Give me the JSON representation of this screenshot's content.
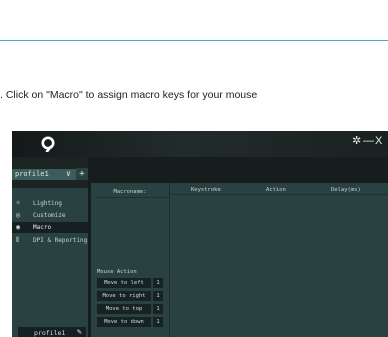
{
  "instruction": ". Click on \"Macro\" to assign macro keys for your mouse",
  "app": {
    "window_controls": {
      "settings": "✲",
      "minimize": "—",
      "close": "X"
    },
    "sidebar": {
      "profile_select": {
        "value": "profile1",
        "chevron": "∨",
        "add": "+"
      },
      "menu": [
        {
          "label": "Lighting",
          "icon": "bulb-icon",
          "glyph": "☼",
          "active": false
        },
        {
          "label": "Customize",
          "icon": "target-icon",
          "glyph": "◎",
          "active": false
        },
        {
          "label": "Macro",
          "icon": "macro-icon",
          "glyph": "◉",
          "active": true
        },
        {
          "label": "DPI & Reporting",
          "icon": "sliders-icon",
          "glyph": "⫴",
          "active": false
        }
      ],
      "profile_footer": {
        "label": "profile1",
        "edit": "✎"
      }
    },
    "macro_panel": {
      "macro_name_header": "Macroname:",
      "mouse_action_label": "Mouse Action",
      "actions": [
        {
          "label": "Move to left",
          "value": "1"
        },
        {
          "label": "Move to right",
          "value": "1"
        },
        {
          "label": "Move to top",
          "value": "1"
        },
        {
          "label": "Move to down",
          "value": "1"
        }
      ],
      "columns": [
        "Keystroke",
        "Action",
        "Delay(ms)"
      ]
    }
  },
  "colors": {
    "accent_rule": "#4aa3df",
    "panel": "#2a4141",
    "dark": "#171d1d"
  }
}
